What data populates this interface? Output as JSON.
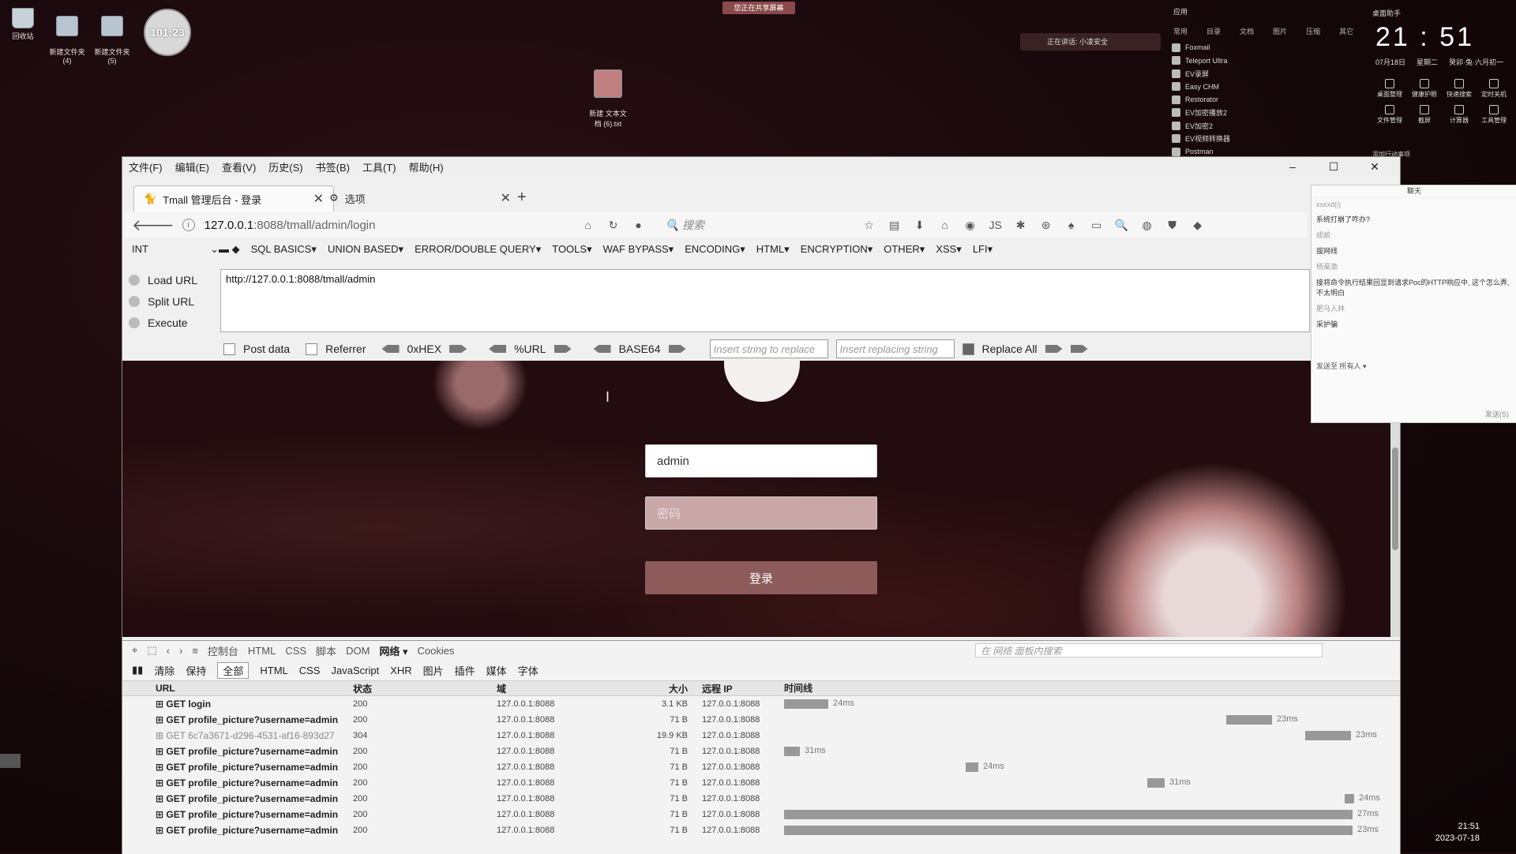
{
  "desktop": {
    "icons": [
      {
        "label": "回收站"
      },
      {
        "label": "新建文件夹\n(4)"
      },
      {
        "label": "新建文件夹\n(5)"
      },
      {
        "label": "新建 文本文\n档 (6).txt"
      }
    ],
    "clock_badge": "101:23",
    "share_bar": "您正在共享屏幕",
    "meeting_bar": "正在讲话: 小凌安全",
    "apps_widget": {
      "header": "应用",
      "categories": [
        "常用",
        "目录",
        "文档",
        "图片",
        "压缩",
        "其它"
      ],
      "apps": [
        "Foxmail",
        "Teleport Ultra",
        "EV录屏",
        "Easy CHM",
        "Restorator",
        "EV加密播放2",
        "EV加密2",
        "EV视频转换器",
        "Postman"
      ]
    },
    "clock_widget": {
      "label": "桌面助手",
      "time": "21 : 51",
      "date": "07月18日",
      "weekday": "星期二",
      "lunar": "癸卯·兔·六月初一",
      "tools": [
        "桌面整理",
        "健康护眼",
        "快速搜索",
        "定时关机",
        "文件管理",
        "截屏",
        "计算器",
        "工具管理"
      ],
      "bottom": "添加行动事项"
    },
    "taskbar_time": "21:51",
    "taskbar_date": "2023-07-18"
  },
  "browser": {
    "menu": [
      "文件(F)",
      "编辑(E)",
      "查看(V)",
      "历史(S)",
      "书签(B)",
      "工具(T)",
      "帮助(H)"
    ],
    "tabs": [
      {
        "label": "Tmall 管理后台 - 登录",
        "active": true
      },
      {
        "label": "选项",
        "active": false
      }
    ],
    "url_host": "127.0.0.1",
    "url_path": ":8088/tmall/admin/login",
    "search_placeholder": "搜索",
    "hackbar": {
      "select": "INT",
      "menus": [
        "SQL BASICS▾",
        "UNION BASED▾",
        "ERROR/DOUBLE QUERY▾",
        "TOOLS▾",
        "WAF BYPASS▾",
        "ENCODING▾",
        "HTML▾",
        "ENCRYPTION▾",
        "OTHER▾",
        "XSS▾",
        "LFI▾"
      ],
      "load_url": "Load URL",
      "split_url": "Split URL",
      "execute": "Execute",
      "url_value": "http://127.0.0.1:8088/tmall/admin",
      "post_data": "Post data",
      "referrer": "Referrer",
      "hex": "0xHEX",
      "urlenc": "%URL",
      "base64": "BASE64",
      "replace_placeholder": "Insert string to replace",
      "replacing_placeholder": "Insert replacing string",
      "replace_all": "Replace All"
    }
  },
  "login": {
    "username": "admin",
    "password_placeholder": "密码",
    "submit": "登录"
  },
  "devtools": {
    "tabs": [
      "控制台",
      "HTML",
      "CSS",
      "脚本",
      "DOM",
      "网络 ▾",
      "Cookies"
    ],
    "search_placeholder": "在 网络 面板内搜索",
    "filters": [
      "清除",
      "保持",
      "全部",
      "HTML",
      "CSS",
      "JavaScript",
      "XHR",
      "图片",
      "插件",
      "媒体",
      "字体"
    ],
    "columns": [
      "URL",
      "状态",
      "域",
      "大小",
      "远程 IP",
      "时间线"
    ],
    "rows": [
      {
        "url": "GET login",
        "status": "200",
        "domain": "127.0.0.1:8088",
        "size": "3.1 KB",
        "ip": "127.0.0.1:8088",
        "time": "24ms",
        "grey": false
      },
      {
        "url": "GET profile_picture?username=admin",
        "status": "200",
        "domain": "127.0.0.1:8088",
        "size": "71 B",
        "ip": "127.0.0.1:8088",
        "time": "23ms",
        "grey": false
      },
      {
        "url": "GET 6c7a3671-d296-4531-af16-893d27",
        "status": "304",
        "domain": "127.0.0.1:8088",
        "size": "19.9 KB",
        "ip": "127.0.0.1:8088",
        "time": "23ms",
        "grey": true
      },
      {
        "url": "GET profile_picture?username=admin",
        "status": "200",
        "domain": "127.0.0.1:8088",
        "size": "71 B",
        "ip": "127.0.0.1:8088",
        "time": "31ms",
        "grey": false
      },
      {
        "url": "GET profile_picture?username=admin",
        "status": "200",
        "domain": "127.0.0.1:8088",
        "size": "71 B",
        "ip": "127.0.0.1:8088",
        "time": "24ms",
        "grey": false
      },
      {
        "url": "GET profile_picture?username=admin",
        "status": "200",
        "domain": "127.0.0.1:8088",
        "size": "71 B",
        "ip": "127.0.0.1:8088",
        "time": "31ms",
        "grey": false
      },
      {
        "url": "GET profile_picture?username=admin",
        "status": "200",
        "domain": "127.0.0.1:8088",
        "size": "71 B",
        "ip": "127.0.0.1:8088",
        "time": "24ms",
        "grey": false
      },
      {
        "url": "GET profile_picture?username=admin",
        "status": "200",
        "domain": "127.0.0.1:8088",
        "size": "71 B",
        "ip": "127.0.0.1:8088",
        "time": "27ms",
        "grey": false
      },
      {
        "url": "GET profile_picture?username=admin",
        "status": "200",
        "domain": "127.0.0.1:8088",
        "size": "71 B",
        "ip": "127.0.0.1:8088",
        "time": "23ms",
        "grey": false
      }
    ]
  },
  "chat": {
    "title": "聊天",
    "messages": [
      {
        "name": "xxxxd(i)",
        "text": "系统打崩了咋办?"
      },
      {
        "name": "成蛟",
        "text": "拔网线"
      },
      {
        "name": "杨渠渤",
        "text": "接将命令执行结果回显到请求Poc的HTTP响应中, 这个怎么弄, 不太明白"
      },
      {
        "name": "肥马入林",
        "text": "采护骗"
      }
    ],
    "send_to": "发送至",
    "everyone": "所有人 ▾",
    "send": "发送(S)"
  }
}
